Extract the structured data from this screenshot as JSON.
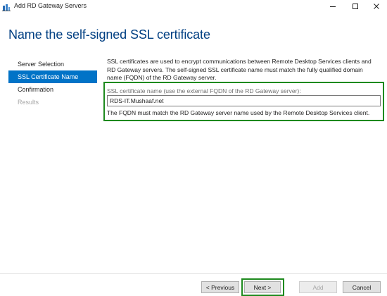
{
  "window": {
    "title": "Add RD Gateway Servers",
    "icon": "server-manager-icon",
    "controls": [
      "minimize-icon",
      "maximize-icon",
      "close-icon"
    ]
  },
  "header": {
    "title": "Name the self-signed SSL certificate"
  },
  "nav": {
    "items": [
      {
        "label": "Server Selection",
        "state": "normal"
      },
      {
        "label": "SSL Certificate Name",
        "state": "active"
      },
      {
        "label": "Confirmation",
        "state": "normal"
      },
      {
        "label": "Results",
        "state": "disabled"
      }
    ]
  },
  "content": {
    "description_line1": "SSL certificates are used to encrypt communications between Remote Desktop Services clients and",
    "description_line2": "RD Gateway servers. The self-signed SSL certificate name must match the fully qualified domain",
    "description_line3": "name (FQDN) of the RD Gateway server.",
    "field_label": "SSL certificate name (use the external FQDN of the RD Gateway server):",
    "field_value": "RDS-IT.Mushaaf.net",
    "hint": "The FQDN must match the RD Gateway server name used by the Remote Desktop Services client."
  },
  "footer": {
    "previous_label": "< Previous",
    "next_label": "Next >",
    "add_label": "Add",
    "cancel_label": "Cancel"
  },
  "colors": {
    "header": "#003f82",
    "nav_active_bg": "#0173c7",
    "highlight_border": "#1e8a1e",
    "disabled_text": "#a6a6a6"
  }
}
